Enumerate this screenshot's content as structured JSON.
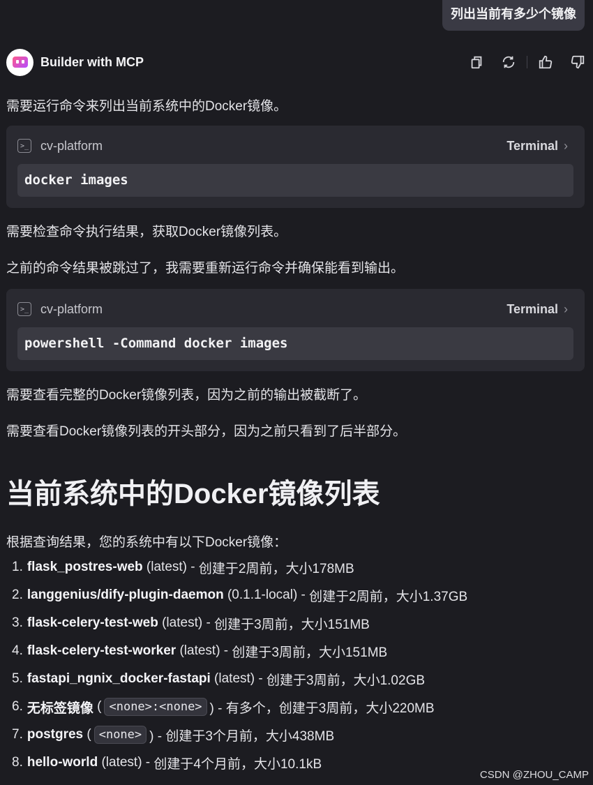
{
  "user_message": "列出当前有多少个镜像",
  "bot": {
    "name": "Builder with MCP",
    "actions": [
      "copy-icon",
      "refresh-icon",
      "thumbs-up-icon",
      "thumbs-down-icon"
    ]
  },
  "paragraphs": {
    "p1": "需要运行命令来列出当前系统中的Docker镜像。",
    "p2": "需要检查命令执行结果，获取Docker镜像列表。",
    "p3": "之前的命令结果被跳过了，我需要重新运行命令并确保能看到输出。",
    "p4": "需要查看完整的Docker镜像列表，因为之前的输出被截断了。",
    "p5": "需要查看Docker镜像列表的开头部分，因为之前只看到了后半部分。",
    "intro": "根据查询结果，您的系统中有以下Docker镜像："
  },
  "tools": [
    {
      "platform": "cv-platform",
      "kind": "Terminal",
      "command": "docker images"
    },
    {
      "platform": "cv-platform",
      "kind": "Terminal",
      "command": "powershell -Command docker images"
    }
  ],
  "heading": "当前系统中的Docker镜像列表",
  "images": [
    {
      "num": "1.",
      "name": "flask_postres-web",
      "pre": " (latest) - ",
      "detail": "创建于2周前，大小178MB"
    },
    {
      "num": "2.",
      "name": "langgenius/dify-plugin-daemon",
      "pre": " (0.1.1-local) - ",
      "detail": "创建于2周前，大小1.37GB"
    },
    {
      "num": "3.",
      "name": "flask-celery-test-web",
      "pre": " (latest) - ",
      "detail": "创建于3周前，大小151MB"
    },
    {
      "num": "4.",
      "name": "flask-celery-test-worker",
      "pre": " (latest) - ",
      "detail": "创建于3周前，大小151MB"
    },
    {
      "num": "5.",
      "name": "fastapi_ngnix_docker-fastapi",
      "pre": " (latest) - ",
      "detail": "创建于3周前，大小1.02GB"
    }
  ],
  "image6": {
    "num": "6.",
    "name": "无标签镜像",
    "code": "<none>:<none>",
    "detail": ") - 有多个，创建于3周前，大小220MB"
  },
  "image7": {
    "num": "7.",
    "name": "postgres",
    "code": "<none>",
    "detail": ") - 创建于3个月前，大小438MB"
  },
  "image8": {
    "num": "8.",
    "name": "hello-world",
    "pre": " (latest) - ",
    "detail": "创建于4个月前，大小10.1kB"
  },
  "watermark": "CSDN @ZHOU_CAMP"
}
